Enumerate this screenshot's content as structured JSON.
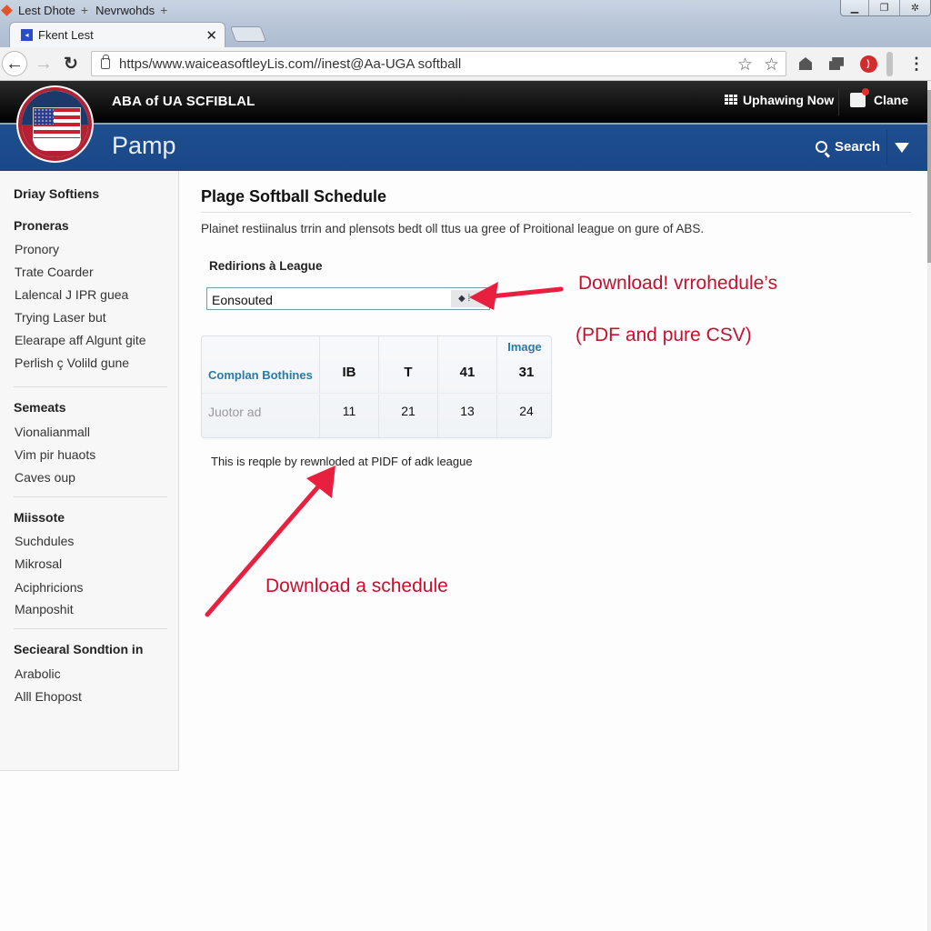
{
  "browser": {
    "bookmarks": [
      {
        "label": "Lest Dhote",
        "icon": "orange-diamond-icon"
      },
      {
        "label": "Nevrwohds",
        "icon": "plus-icon"
      }
    ],
    "tab": {
      "title": "Fkent Lest",
      "close": "✕"
    },
    "url": "https/www.waiceasoftleyLis.com//inest@Aa-UGA softball",
    "window_controls": [
      "minimize",
      "restore",
      "close"
    ]
  },
  "site": {
    "brand": "ABA of UA  SCFIBLAL",
    "title": "Pamp",
    "top_links": [
      {
        "label": "Uphawing Now",
        "icon": "grid-icon"
      },
      {
        "label": "Clane",
        "icon": "bag-icon"
      }
    ],
    "search_label": "Search"
  },
  "sidebar": {
    "heading": "Driay Softiens",
    "sections": [
      {
        "title": "Proneras",
        "items": [
          "Pronory",
          "Trate Coarder",
          "Lalencal J IPR guea",
          "Trying Laser but",
          "Elearape aff Algunt gite",
          "Perlish ç Volild gune"
        ]
      },
      {
        "title": "Semeats",
        "items": [
          "Vionalianmall",
          "Vim pir huaots",
          "Caves oup"
        ]
      },
      {
        "title": "Miissote",
        "items": [
          "Suchdules",
          "Mikrosal",
          "Aciphricions",
          "Manposhit"
        ]
      },
      {
        "title": "Seciearal Sondtion in",
        "items": [
          "Arabolic",
          "Alll Ehopost"
        ]
      }
    ]
  },
  "main": {
    "title": "Plage Softball Schedule",
    "description": "Plainet restiinalus trrin and plensots bedt oll ttus ua gree of Proitional league on gure of ABS.",
    "league_label": "Redirions à League",
    "league_select_value": "Eonsouted",
    "table": {
      "top_label": "Image",
      "header_label": "Complan Bothines",
      "header_cells": [
        "IB",
        "T",
        "41",
        "31"
      ],
      "row_label": "Juotor ad",
      "row_cells": [
        "11",
        "21",
        "13",
        "24"
      ]
    },
    "note": "This is reqple by rewnloded at PIDF of adk league"
  },
  "annotations": {
    "download_line1": "Download! vrrohedule’s",
    "download_line2": "(PDF and pure CSV)",
    "download_schedule": "Download a schedule",
    "color": "#c8102e",
    "arrow_color": "#e8203f"
  }
}
